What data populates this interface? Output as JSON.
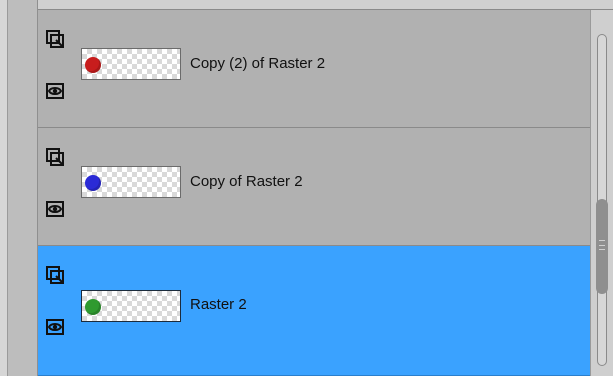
{
  "layers": [
    {
      "name": "Copy (2) of Raster 2",
      "selected": false,
      "thumb_color": "#c81d1d",
      "icons": [
        "layer-properties-icon",
        "visibility-eye-icon"
      ]
    },
    {
      "name": "Copy of Raster 2",
      "selected": false,
      "thumb_color": "#2a2ad6",
      "icons": [
        "layer-properties-icon",
        "visibility-eye-icon"
      ]
    },
    {
      "name": "Raster 2",
      "selected": true,
      "thumb_color": "#2f9a2f",
      "icons": [
        "layer-properties-icon",
        "visibility-eye-icon"
      ]
    }
  ],
  "colors": {
    "panel_bg": "#b1b1b1",
    "selected_bg": "#3aa2ff",
    "gutter_bg": "#bdbdbd",
    "scrollbar_bg": "#cfcfcf"
  }
}
